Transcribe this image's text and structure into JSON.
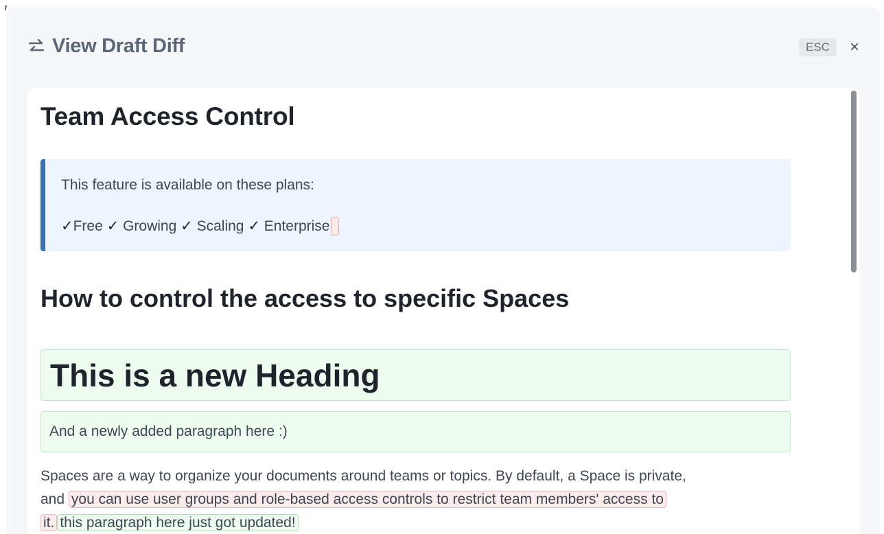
{
  "modal": {
    "title": "View Draft Diff",
    "esc_label": "ESC",
    "close_glyph": "×",
    "title_icon": "swap-arrows-icon"
  },
  "document": {
    "title": "Team Access Control",
    "callout": {
      "line1": "This feature is available on these plans:",
      "check_glyph": "✓",
      "plans": [
        "Free",
        "Growing",
        "Scaling",
        "Enterprise"
      ]
    },
    "section_heading": "How to control the access to specific Spaces",
    "added_heading": "This is a new Heading",
    "added_paragraph": "And a newly added paragraph here :)",
    "paragraph": {
      "line1": "Spaces are a way to organize your documents around teams or topics. By default, a Space is private,",
      "line2_prefix": "and",
      "removed_part1": "you can use user groups and role-based access controls to restrict team members' access to",
      "removed_part2": "it.",
      "inserted": "this paragraph here just got updated!"
    }
  },
  "colors": {
    "callout_accent": "#3b6fb6",
    "added_bg": "#eefcf0",
    "removed_bg": "#fdecec"
  }
}
